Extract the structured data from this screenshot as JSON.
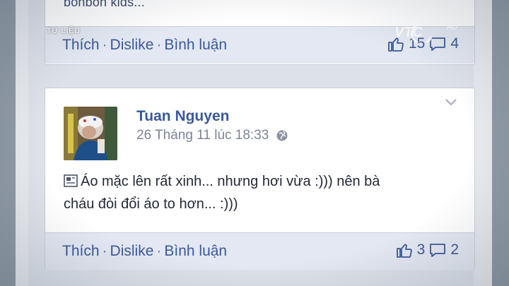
{
  "overlay": {
    "section_label": "TƯ LIỆU",
    "channel_logo_text": "VTC",
    "channel_badge": "HD"
  },
  "post1": {
    "snippet": "bonbon kids...",
    "actions": {
      "like": "Thích",
      "dislike": "Dislike",
      "comment": "Bình luận"
    },
    "like_count": "15",
    "comment_count": "4"
  },
  "post2": {
    "author": "Tuan Nguyen",
    "timestamp": "26 Tháng 11 lúc 18:33",
    "message_line1": "Áo mặc lên rất xinh... nhưng hơi vừa :))) nên bà",
    "message_line2": "cháu đòi đổi áo to hơn... :)))",
    "actions": {
      "like": "Thích",
      "dislike": "Dislike",
      "comment": "Bình luận"
    },
    "like_count": "3",
    "comment_count": "2"
  },
  "icons": [
    "like-icon",
    "comment-icon",
    "globe-icon",
    "chevron-down-icon",
    "document-icon"
  ],
  "colors": {
    "link": "#3b5998",
    "action_bar": "#e3e8f2",
    "meta_text": "#7b8597"
  }
}
